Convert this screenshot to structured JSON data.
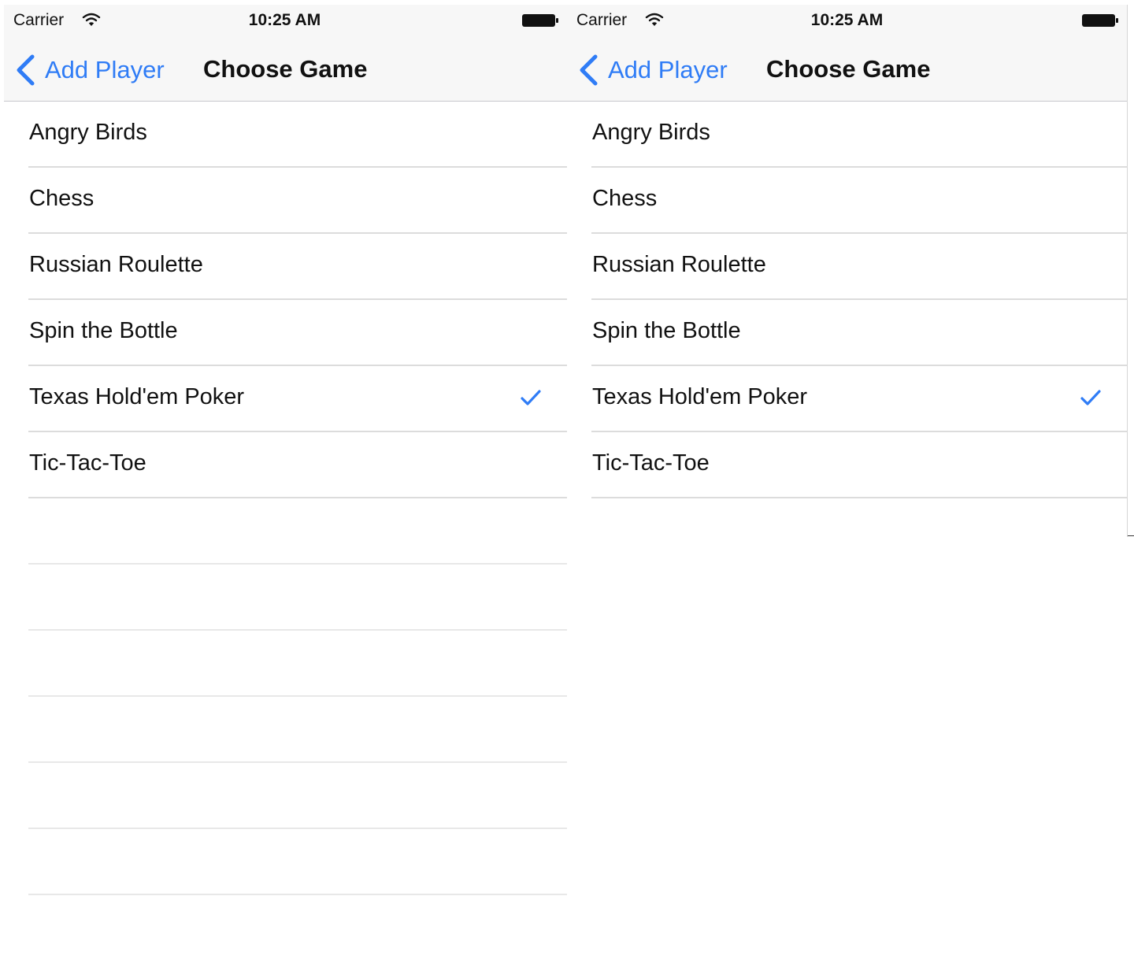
{
  "phones": [
    {
      "status": {
        "carrier": "Carrier",
        "time": "10:25 AM"
      },
      "nav": {
        "back_label": "Add Player",
        "title": "Choose Game"
      },
      "games": [
        "Angry Birds",
        "Chess",
        "Russian Roulette",
        "Spin the Bottle",
        "Texas Hold'em Poker",
        "Tic-Tac-Toe"
      ],
      "selected_game": "Texas Hold'em Poker",
      "empty_rows_visible": 7
    },
    {
      "status": {
        "carrier": "Carrier",
        "time": "10:25 AM"
      },
      "nav": {
        "back_label": "Add Player",
        "title": "Choose Game"
      },
      "games": [
        "Angry Birds",
        "Chess",
        "Russian Roulette",
        "Spin the Bottle",
        "Texas Hold'em Poker",
        "Tic-Tac-Toe"
      ],
      "selected_game": "Texas Hold'em Poker",
      "empty_rows_visible": 0
    }
  ],
  "colors": {
    "tint": "#2f7cf6",
    "bar_background": "#f7f7f7",
    "separator": "#dcdcdc"
  },
  "icons": {
    "wifi": "wifi-icon",
    "battery": "battery-icon",
    "back": "chevron-left-icon",
    "check": "checkmark-icon"
  }
}
